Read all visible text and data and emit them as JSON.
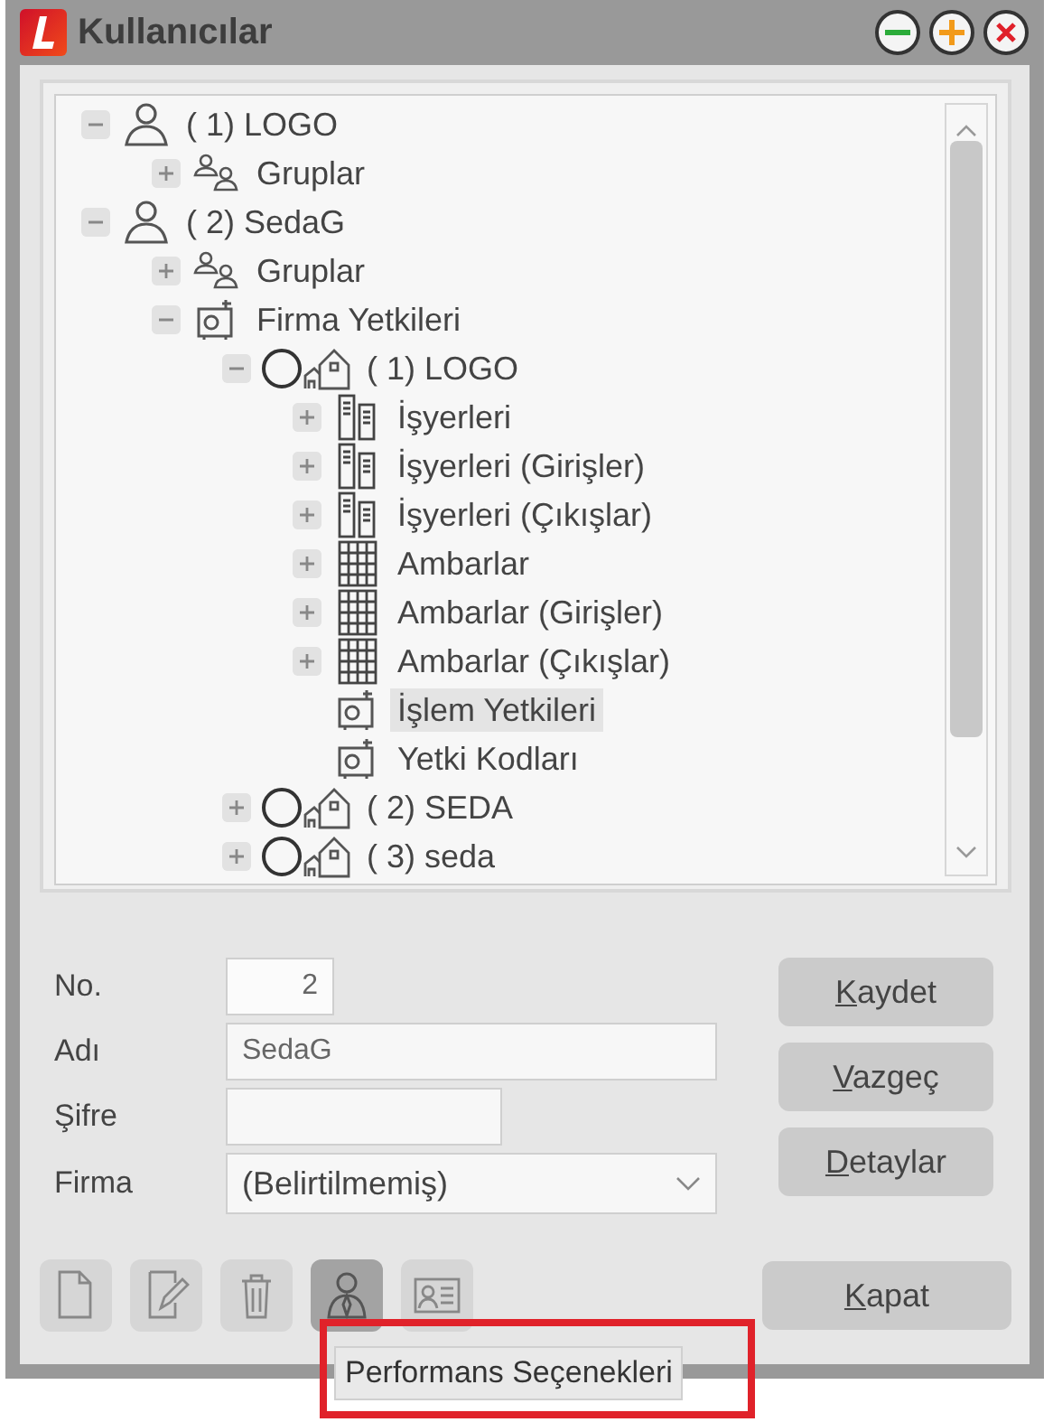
{
  "window": {
    "title": "Kullanıcılar"
  },
  "title_buttons": [
    {
      "kind": "minimize"
    },
    {
      "kind": "maximize"
    },
    {
      "kind": "close"
    }
  ],
  "tree": [
    {
      "label": "( 1) LOGO",
      "kind": "user",
      "expanded": true,
      "children": [
        {
          "label": "Gruplar",
          "kind": "group",
          "expanded": false
        }
      ]
    },
    {
      "label": "( 2) SedaG",
      "kind": "user",
      "expanded": true,
      "children": [
        {
          "label": "Gruplar",
          "kind": "group",
          "expanded": false
        },
        {
          "label": "Firma Yetkileri",
          "kind": "safe",
          "expanded": true,
          "children": [
            {
              "label": "(  1) LOGO",
              "kind": "company",
              "checked": false,
              "expanded": true,
              "children": [
                {
                  "label": "İşyerleri",
                  "kind": "workplace",
                  "expanded": false,
                  "selected": false
                },
                {
                  "label": "İşyerleri (Girişler)",
                  "kind": "workplace",
                  "expanded": false,
                  "selected": false
                },
                {
                  "label": "İşyerleri (Çıkışlar)",
                  "kind": "workplace",
                  "expanded": false,
                  "selected": false
                },
                {
                  "label": "Ambarlar",
                  "kind": "warehouse",
                  "expanded": false,
                  "selected": false
                },
                {
                  "label": "Ambarlar (Girişler)",
                  "kind": "warehouse",
                  "expanded": false,
                  "selected": false
                },
                {
                  "label": "Ambarlar (Çıkışlar)",
                  "kind": "warehouse",
                  "expanded": false,
                  "selected": false
                },
                {
                  "label": "İşlem Yetkileri",
                  "kind": "safe",
                  "selected": true
                },
                {
                  "label": "Yetki Kodları",
                  "kind": "safe",
                  "selected": false
                }
              ]
            },
            {
              "label": "(  2) SEDA",
              "kind": "company",
              "checked": false,
              "expanded": false
            },
            {
              "label": "(  3) seda",
              "kind": "company",
              "checked": false,
              "expanded": false
            }
          ]
        }
      ]
    }
  ],
  "form": {
    "fields": [
      {
        "label": "No.",
        "value": "2",
        "kind": "number"
      },
      {
        "label": "Adı",
        "value": "SedaG",
        "kind": "text"
      },
      {
        "label": "Şifre",
        "kind": "password"
      },
      {
        "label": "Firma",
        "value": "(Belirtilmemiş)",
        "kind": "select"
      }
    ]
  },
  "buttons": [
    {
      "label": "Kaydet"
    },
    {
      "label": "Vazgeç"
    },
    {
      "label": "Detaylar"
    }
  ],
  "toolbar": [
    {
      "kind": "new",
      "pressed": false
    },
    {
      "kind": "edit",
      "pressed": false
    },
    {
      "kind": "delete",
      "pressed": false
    },
    {
      "kind": "user",
      "pressed": true
    },
    {
      "kind": "card",
      "pressed": false
    }
  ],
  "close_button": {
    "label": "Kapat"
  },
  "tooltip": {
    "text": "Performans Seçenekleri",
    "highlighted": true
  }
}
